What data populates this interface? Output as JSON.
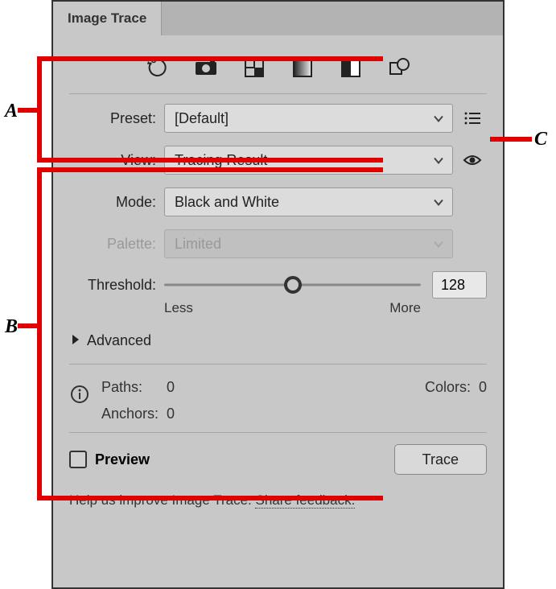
{
  "tab": {
    "title": "Image Trace"
  },
  "iconRow": {
    "auto": "auto-color-icon",
    "high": "high-color-icon",
    "low": "low-color-icon",
    "gray": "grayscale-icon",
    "bw": "black-white-icon",
    "outline": "outline-icon"
  },
  "preset": {
    "label": "Preset:",
    "value": "[Default]"
  },
  "view": {
    "label": "View:",
    "value": "Tracing Result"
  },
  "mode": {
    "label": "Mode:",
    "value": "Black and White"
  },
  "palette": {
    "label": "Palette:",
    "value": "Limited"
  },
  "threshold": {
    "label": "Threshold:",
    "value": "128",
    "min": "Less",
    "max": "More"
  },
  "advanced": {
    "label": "Advanced"
  },
  "stats": {
    "pathsLabel": "Paths:",
    "pathsValue": "0",
    "colorsLabel": "Colors:",
    "colorsValue": "0",
    "anchorsLabel": "Anchors:",
    "anchorsValue": "0"
  },
  "preview": {
    "label": "Preview"
  },
  "trace": {
    "label": "Trace"
  },
  "help": {
    "text": "Help us improve Image Trace. ",
    "link": "Share feedback."
  },
  "callouts": {
    "a": "A",
    "b": "B",
    "c": "C"
  }
}
